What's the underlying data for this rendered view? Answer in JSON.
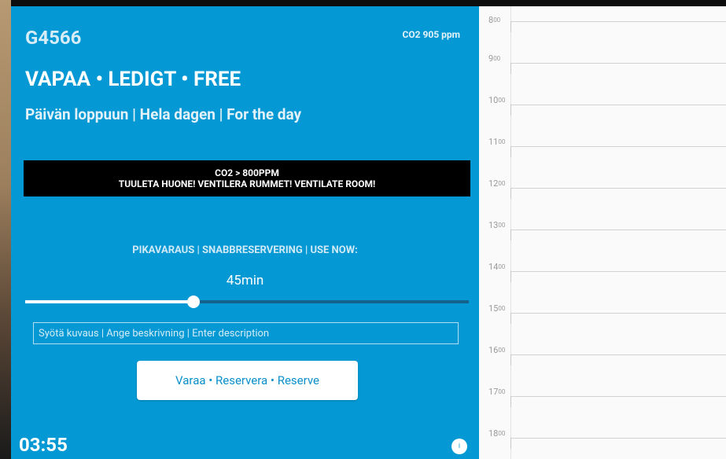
{
  "room": {
    "name": "G4566",
    "co2_readout": "CO2 905 ppm",
    "status": "VAPAA • LEDIGT • FREE",
    "duration": "Päivän loppuun | Hela dagen | For the day"
  },
  "alert": {
    "line1": "CO2 > 800PPM",
    "line2": "TUULETA HUONE!  VENTILERA RUMMET!  VENTILATE ROOM!"
  },
  "quick_reserve": {
    "label": "PIKAVARAUS | SNABBRESERVERING | USE NOW:",
    "value": "45min",
    "slider_fraction": 0.38,
    "description_placeholder": "Syötä kuvaus | Ange beskrivning | Enter description",
    "button_label": "Varaa • Reservera • Reserve"
  },
  "clock": "03:55",
  "info_label": "i",
  "calendar": {
    "hours": [
      {
        "h": "8",
        "m": "00"
      },
      {
        "h": "9",
        "m": "00"
      },
      {
        "h": "10",
        "m": "00"
      },
      {
        "h": "11",
        "m": "00"
      },
      {
        "h": "12",
        "m": "00"
      },
      {
        "h": "13",
        "m": "00"
      },
      {
        "h": "14",
        "m": "00"
      },
      {
        "h": "15",
        "m": "00"
      },
      {
        "h": "16",
        "m": "00"
      },
      {
        "h": "17",
        "m": "00"
      },
      {
        "h": "18",
        "m": "00"
      }
    ]
  },
  "colors": {
    "panel_bg": "#0499d4",
    "alert_bg": "#000000",
    "button_text": "#0a8fcb"
  }
}
